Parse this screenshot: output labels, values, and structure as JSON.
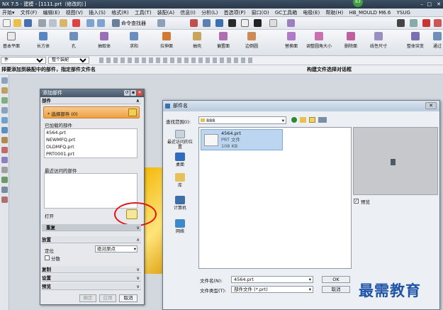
{
  "app": {
    "title": "NX 7.5 - 建模 - [1111.prt（修改的）]",
    "badge": "63"
  },
  "menubar": {
    "items": [
      "开始▾",
      "文件(F)",
      "编辑(E)",
      "视图(V)",
      "插入(S)",
      "格式(R)",
      "工具(T)",
      "装配(A)",
      "信息(I)",
      "分析(L)",
      "首选项(P)",
      "窗口(O)",
      "GC工具箱",
      "电极(E)",
      "帮助(H)",
      "HB_MOULD M6.6",
      "YSUG"
    ]
  },
  "toolbar1": {
    "command_finder": "命令查找器"
  },
  "toolbar2": {
    "items": [
      "基本平面",
      "长方体",
      "孔",
      "抽取体",
      "求和",
      "拉伸面",
      "抽壳",
      "偏置面",
      "边倒圆",
      "替换面",
      "调整圆角大小",
      "删除面",
      "线性尺寸",
      "整体突变",
      "通过"
    ]
  },
  "selbar": {
    "filter_value": "件",
    "scope_value": "整个装配"
  },
  "cuebar": {
    "prompt": "择要添加到装配中的部件，指定部件文件名",
    "status": "构建文件选择对话框"
  },
  "add_component_dialog": {
    "title": "添加部件",
    "section_part": "部件",
    "select_part": "* 选择部件 (0)",
    "loaded_label": "已加载的部件",
    "loaded_parts": [
      "4564.prt",
      "NEWMFQ.prt",
      "OLDMFQ.prt",
      "PRT0001.prt"
    ],
    "recent_label": "最近访问的部件",
    "open_label": "打开",
    "repeat_label": "重复",
    "placement_label": "放置",
    "position_label": "定位",
    "position_value": "绝对原点",
    "scatter_label": "分散",
    "copy_label": "复制",
    "settings_label": "设置",
    "preview_label": "预览",
    "ok": "确定",
    "apply": "应用",
    "cancel": "取消"
  },
  "part_name_dialog": {
    "title": "部件名",
    "lookin_label": "查找范围(I):",
    "lookin_value": "888",
    "places": [
      "最近访问的位置",
      "桌面",
      "库",
      "计算机",
      "网络"
    ],
    "file": {
      "name": "4564.prt",
      "type": "PRT 文件",
      "size": "108 KB"
    },
    "preview_checkbox": "预览",
    "filename_label": "文件名(N):",
    "filename_value": "4564.prt",
    "filetype_label": "文件类型(T):",
    "filetype_value": "部件文件 (*.prt)",
    "ok": "OK",
    "cancel": "取消"
  },
  "watermark": "最需教育",
  "colors": {
    "accent_orange": "#f0a040",
    "highlight_red": "#e0141b",
    "titlebar": "#3c4f63"
  }
}
